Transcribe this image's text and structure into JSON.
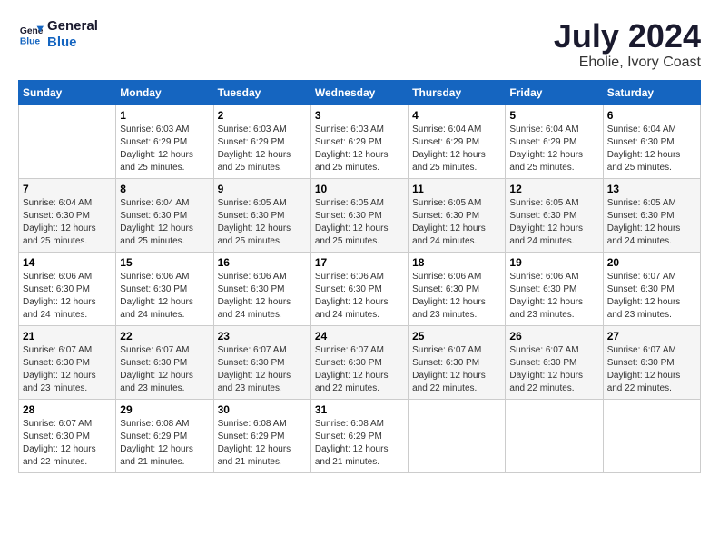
{
  "logo": {
    "line1": "General",
    "line2": "Blue"
  },
  "title": {
    "month_year": "July 2024",
    "location": "Eholie, Ivory Coast"
  },
  "days_of_week": [
    "Sunday",
    "Monday",
    "Tuesday",
    "Wednesday",
    "Thursday",
    "Friday",
    "Saturday"
  ],
  "weeks": [
    [
      {
        "day": "",
        "info": ""
      },
      {
        "day": "1",
        "info": "Sunrise: 6:03 AM\nSunset: 6:29 PM\nDaylight: 12 hours\nand 25 minutes."
      },
      {
        "day": "2",
        "info": "Sunrise: 6:03 AM\nSunset: 6:29 PM\nDaylight: 12 hours\nand 25 minutes."
      },
      {
        "day": "3",
        "info": "Sunrise: 6:03 AM\nSunset: 6:29 PM\nDaylight: 12 hours\nand 25 minutes."
      },
      {
        "day": "4",
        "info": "Sunrise: 6:04 AM\nSunset: 6:29 PM\nDaylight: 12 hours\nand 25 minutes."
      },
      {
        "day": "5",
        "info": "Sunrise: 6:04 AM\nSunset: 6:29 PM\nDaylight: 12 hours\nand 25 minutes."
      },
      {
        "day": "6",
        "info": "Sunrise: 6:04 AM\nSunset: 6:30 PM\nDaylight: 12 hours\nand 25 minutes."
      }
    ],
    [
      {
        "day": "7",
        "info": "Sunrise: 6:04 AM\nSunset: 6:30 PM\nDaylight: 12 hours\nand 25 minutes."
      },
      {
        "day": "8",
        "info": "Sunrise: 6:04 AM\nSunset: 6:30 PM\nDaylight: 12 hours\nand 25 minutes."
      },
      {
        "day": "9",
        "info": "Sunrise: 6:05 AM\nSunset: 6:30 PM\nDaylight: 12 hours\nand 25 minutes."
      },
      {
        "day": "10",
        "info": "Sunrise: 6:05 AM\nSunset: 6:30 PM\nDaylight: 12 hours\nand 25 minutes."
      },
      {
        "day": "11",
        "info": "Sunrise: 6:05 AM\nSunset: 6:30 PM\nDaylight: 12 hours\nand 24 minutes."
      },
      {
        "day": "12",
        "info": "Sunrise: 6:05 AM\nSunset: 6:30 PM\nDaylight: 12 hours\nand 24 minutes."
      },
      {
        "day": "13",
        "info": "Sunrise: 6:05 AM\nSunset: 6:30 PM\nDaylight: 12 hours\nand 24 minutes."
      }
    ],
    [
      {
        "day": "14",
        "info": "Sunrise: 6:06 AM\nSunset: 6:30 PM\nDaylight: 12 hours\nand 24 minutes."
      },
      {
        "day": "15",
        "info": "Sunrise: 6:06 AM\nSunset: 6:30 PM\nDaylight: 12 hours\nand 24 minutes."
      },
      {
        "day": "16",
        "info": "Sunrise: 6:06 AM\nSunset: 6:30 PM\nDaylight: 12 hours\nand 24 minutes."
      },
      {
        "day": "17",
        "info": "Sunrise: 6:06 AM\nSunset: 6:30 PM\nDaylight: 12 hours\nand 24 minutes."
      },
      {
        "day": "18",
        "info": "Sunrise: 6:06 AM\nSunset: 6:30 PM\nDaylight: 12 hours\nand 23 minutes."
      },
      {
        "day": "19",
        "info": "Sunrise: 6:06 AM\nSunset: 6:30 PM\nDaylight: 12 hours\nand 23 minutes."
      },
      {
        "day": "20",
        "info": "Sunrise: 6:07 AM\nSunset: 6:30 PM\nDaylight: 12 hours\nand 23 minutes."
      }
    ],
    [
      {
        "day": "21",
        "info": "Sunrise: 6:07 AM\nSunset: 6:30 PM\nDaylight: 12 hours\nand 23 minutes."
      },
      {
        "day": "22",
        "info": "Sunrise: 6:07 AM\nSunset: 6:30 PM\nDaylight: 12 hours\nand 23 minutes."
      },
      {
        "day": "23",
        "info": "Sunrise: 6:07 AM\nSunset: 6:30 PM\nDaylight: 12 hours\nand 23 minutes."
      },
      {
        "day": "24",
        "info": "Sunrise: 6:07 AM\nSunset: 6:30 PM\nDaylight: 12 hours\nand 22 minutes."
      },
      {
        "day": "25",
        "info": "Sunrise: 6:07 AM\nSunset: 6:30 PM\nDaylight: 12 hours\nand 22 minutes."
      },
      {
        "day": "26",
        "info": "Sunrise: 6:07 AM\nSunset: 6:30 PM\nDaylight: 12 hours\nand 22 minutes."
      },
      {
        "day": "27",
        "info": "Sunrise: 6:07 AM\nSunset: 6:30 PM\nDaylight: 12 hours\nand 22 minutes."
      }
    ],
    [
      {
        "day": "28",
        "info": "Sunrise: 6:07 AM\nSunset: 6:30 PM\nDaylight: 12 hours\nand 22 minutes."
      },
      {
        "day": "29",
        "info": "Sunrise: 6:08 AM\nSunset: 6:29 PM\nDaylight: 12 hours\nand 21 minutes."
      },
      {
        "day": "30",
        "info": "Sunrise: 6:08 AM\nSunset: 6:29 PM\nDaylight: 12 hours\nand 21 minutes."
      },
      {
        "day": "31",
        "info": "Sunrise: 6:08 AM\nSunset: 6:29 PM\nDaylight: 12 hours\nand 21 minutes."
      },
      {
        "day": "",
        "info": ""
      },
      {
        "day": "",
        "info": ""
      },
      {
        "day": "",
        "info": ""
      }
    ]
  ]
}
